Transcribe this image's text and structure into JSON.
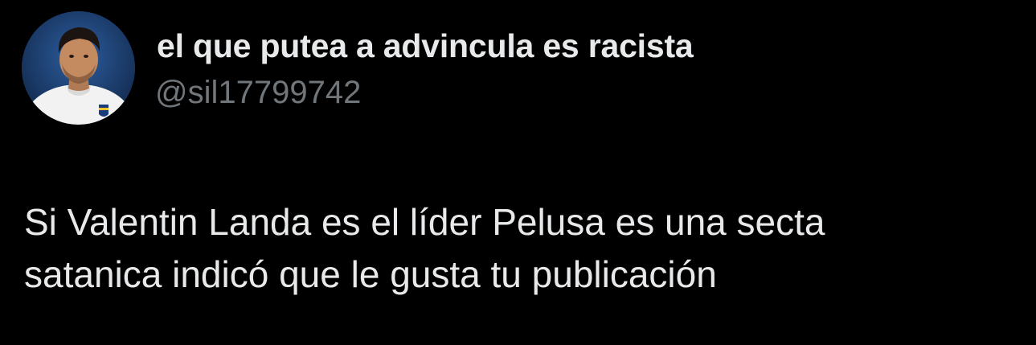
{
  "tweet": {
    "author": {
      "display_name": "el que putea a advincula es racista",
      "handle": "@sil17799742",
      "avatar_icon": "profile-photo-avatar"
    },
    "text_lines": [
      "Si Valentin Landa es el líder Pelusa es una secta",
      "satanica indicó que le gusta tu publicación"
    ]
  },
  "colors": {
    "background": "#000000",
    "primary_text": "#e7e9ea",
    "secondary_text": "#71767b"
  }
}
